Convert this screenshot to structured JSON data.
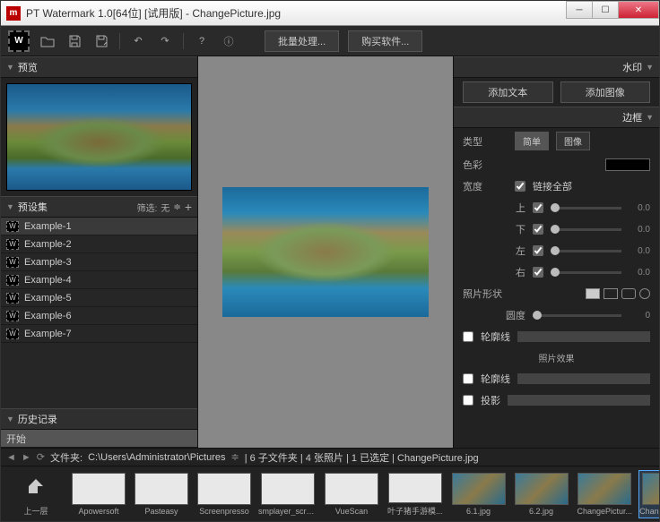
{
  "window": {
    "title": "PT Watermark 1.0[64位] [试用版] - ChangePicture.jpg"
  },
  "toolbar": {
    "batch_btn": "批量处理...",
    "buy_btn": "购买软件..."
  },
  "left": {
    "preview_header": "预览",
    "preset_header": "预设集",
    "preset_filter_label": "筛选:",
    "preset_filter_value": "无",
    "presets": [
      "Example-1",
      "Example-2",
      "Example-3",
      "Example-4",
      "Example-5",
      "Example-6",
      "Example-7"
    ],
    "history_header": "历史记录",
    "history_items": [
      "开始"
    ]
  },
  "right": {
    "watermark_header": "水印",
    "add_text_btn": "添加文本",
    "add_image_btn": "添加图像",
    "border_header": "边框",
    "type_label": "类型",
    "type_tabs": [
      "简单",
      "图像"
    ],
    "color_label": "色彩",
    "color_value": "#000000",
    "width_label": "宽度",
    "link_all_label": "链接全部",
    "link_all_checked": true,
    "sides": [
      {
        "label": "上",
        "checked": true,
        "value": "0.0"
      },
      {
        "label": "下",
        "checked": true,
        "value": "0.0"
      },
      {
        "label": "左",
        "checked": true,
        "value": "0.0"
      },
      {
        "label": "右",
        "checked": true,
        "value": "0.0"
      }
    ],
    "shape_label": "照片形状",
    "roundness_label": "圆度",
    "roundness_value": "0",
    "outline1_label": "轮廓线",
    "effects_label": "照片效果",
    "outline2_label": "轮廓线",
    "shadow_label": "投影"
  },
  "footer": {
    "path_label": "文件夹:",
    "path_value": "C:\\Users\\Administrator\\Pictures",
    "status": "| 6 子文件夹 | 4 张照片 | 1 已选定 | ChangePicture.jpg",
    "items": [
      {
        "name": "上一层",
        "type": "up"
      },
      {
        "name": "Apowersoft",
        "type": "folder"
      },
      {
        "name": "Pasteasy",
        "type": "folder"
      },
      {
        "name": "Screenpresso",
        "type": "folder"
      },
      {
        "name": "smplayer_scre...",
        "type": "folder"
      },
      {
        "name": "VueScan",
        "type": "folder"
      },
      {
        "name": "叶子猪手游模...",
        "type": "folder"
      },
      {
        "name": "6.1.jpg",
        "type": "img"
      },
      {
        "name": "6.2.jpg",
        "type": "img"
      },
      {
        "name": "ChangePictur...",
        "type": "img"
      },
      {
        "name": "ChangePicture...",
        "type": "img",
        "selected": true
      }
    ]
  }
}
